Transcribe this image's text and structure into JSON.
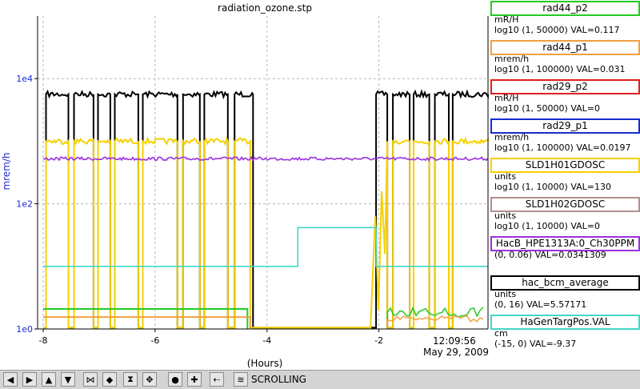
{
  "title": "radiation_ozone.stp",
  "y_axis_label": "mrem/h",
  "x_axis_label": "(Hours)",
  "time_label": "12:09:56",
  "date_label": "May 29, 2009",
  "y_ticks": [
    "1e4",
    "1e2",
    "1e0"
  ],
  "x_ticks": [
    "-8",
    "-6",
    "-4",
    "-2"
  ],
  "legend": [
    {
      "name": "rad44_p2",
      "unit": "mR/H",
      "range": "log10 (1, 50000) VAL=0.117",
      "color": "#22cc22"
    },
    {
      "name": "rad44_p1",
      "unit": "mrem/h",
      "range": "log10 (1, 100000) VAL=0.031",
      "color": "#f0a040"
    },
    {
      "name": "rad29_p2",
      "unit": "mR/H",
      "range": "log10 (1, 50000) VAL=0",
      "color": "#e02020"
    },
    {
      "name": "rad29_p1",
      "unit": "mrem/h",
      "range": "log10 (1, 100000) VAL=0.0197",
      "color": "#1a2ad0"
    },
    {
      "name": "SLD1H01GDOSC",
      "unit": "units",
      "range": "log10 (1, 10000) VAL=130",
      "color": "#f5d000"
    },
    {
      "name": "SLD1H02GDOSC",
      "unit": "units",
      "range": "log10 (1, 10000) VAL=0",
      "color": "#b09090"
    },
    {
      "name": "HacB_HPE1313A:0_Ch30PPM",
      "unit": "",
      "range": "(0, 0.06) VAL=0.0341309",
      "color": "#9a30e0"
    },
    {
      "name": "hac_bcm_average",
      "unit": "units",
      "range": "(0, 16) VAL=5.57171",
      "color": "#000000"
    },
    {
      "name": "HaGenTargPos.VAL",
      "unit": "cm",
      "range": "(-15, 0) VAL=-9.37",
      "color": "#40d8c8"
    }
  ],
  "toolbar": {
    "status_label": "SCROLLING",
    "buttons": [
      "pan-left-icon",
      "pan-right-icon",
      "pan-up-icon",
      "pan-down-icon",
      "zoom-in-x-icon",
      "zoom-out-x-icon",
      "zoom-in-y-icon",
      "zoom-out-y-icon",
      "autoscale-icon",
      "reset-icon",
      "add-icon",
      "back-icon",
      "config-icon",
      "print-icon"
    ]
  },
  "chart_data": {
    "type": "line",
    "title": "radiation_ozone.stp",
    "xlabel": "(Hours)",
    "ylabel": "mrem/h",
    "xlim": [
      -8.1,
      -0.05
    ],
    "ylim_log10": [
      0,
      5
    ],
    "y_scale": "log",
    "grid": true,
    "series": [
      {
        "name": "hac_bcm_average",
        "color": "#000000",
        "style": "toggle",
        "on_log10": 3.75,
        "off_log10": 0.0,
        "segments": [
          [
            -8.0,
            -7.95,
            "off"
          ],
          [
            -7.95,
            -7.55,
            "on"
          ],
          [
            -7.55,
            -7.45,
            "off"
          ],
          [
            -7.45,
            -7.1,
            "on"
          ],
          [
            -7.1,
            -7.02,
            "off"
          ],
          [
            -7.02,
            -6.8,
            "on"
          ],
          [
            -6.8,
            -6.72,
            "off"
          ],
          [
            -6.72,
            -6.3,
            "on"
          ],
          [
            -6.3,
            -6.22,
            "off"
          ],
          [
            -6.22,
            -5.6,
            "on"
          ],
          [
            -5.6,
            -5.5,
            "off"
          ],
          [
            -5.5,
            -5.2,
            "on"
          ],
          [
            -5.2,
            -5.12,
            "off"
          ],
          [
            -5.12,
            -4.7,
            "on"
          ],
          [
            -4.7,
            -4.58,
            "off"
          ],
          [
            -4.58,
            -4.25,
            "on"
          ],
          [
            -4.25,
            -2.05,
            "off"
          ],
          [
            -2.05,
            -1.85,
            "on"
          ],
          [
            -1.85,
            -1.75,
            "off"
          ],
          [
            -1.75,
            -1.45,
            "on"
          ],
          [
            -1.45,
            -1.38,
            "off"
          ],
          [
            -1.38,
            -1.1,
            "on"
          ],
          [
            -1.1,
            -1.0,
            "off"
          ],
          [
            -1.0,
            -0.75,
            "on"
          ],
          [
            -0.75,
            -0.68,
            "off"
          ],
          [
            -0.68,
            -0.05,
            "on"
          ]
        ]
      },
      {
        "name": "SLD1H01GDOSC",
        "color": "#f5d000",
        "style": "toggle",
        "on_log10": 3.0,
        "off_log10": 0.0,
        "segments": [
          [
            -8.0,
            -7.95,
            "off"
          ],
          [
            -7.95,
            -7.55,
            "on"
          ],
          [
            -7.55,
            -7.45,
            "off"
          ],
          [
            -7.45,
            -7.1,
            "on"
          ],
          [
            -7.1,
            -7.02,
            "off"
          ],
          [
            -7.02,
            -6.8,
            "on"
          ],
          [
            -6.8,
            -6.72,
            "off"
          ],
          [
            -6.72,
            -6.3,
            "on"
          ],
          [
            -6.3,
            -6.22,
            "off"
          ],
          [
            -6.22,
            -5.6,
            "on"
          ],
          [
            -5.6,
            -5.5,
            "off"
          ],
          [
            -5.5,
            -5.2,
            "on"
          ],
          [
            -5.2,
            -5.12,
            "off"
          ],
          [
            -5.12,
            -4.7,
            "on"
          ],
          [
            -4.7,
            -4.58,
            "off"
          ],
          [
            -4.58,
            -4.3,
            "on"
          ],
          [
            -4.3,
            -2.15,
            "off"
          ],
          [
            -2.15,
            -1.85,
            "ramp"
          ],
          [
            -1.85,
            -1.75,
            "off"
          ],
          [
            -1.75,
            -1.45,
            "on"
          ],
          [
            -1.45,
            -1.38,
            "off"
          ],
          [
            -1.38,
            -1.1,
            "on"
          ],
          [
            -1.1,
            -1.0,
            "off"
          ],
          [
            -1.0,
            -0.75,
            "on"
          ],
          [
            -0.75,
            -0.68,
            "off"
          ],
          [
            -0.68,
            -0.05,
            "on"
          ]
        ]
      },
      {
        "name": "HacB_HPE1313A:0_Ch30PPM",
        "color": "#9a30e0",
        "style": "flat",
        "value_log10": 2.72,
        "x_end": -0.05
      },
      {
        "name": "HaGenTargPos.VAL",
        "color": "#40d8c8",
        "points": [
          [
            -8.0,
            1.0
          ],
          [
            -3.45,
            1.0
          ],
          [
            -3.45,
            1.62
          ],
          [
            -2.05,
            1.62
          ],
          [
            -2.05,
            1.0
          ],
          [
            -0.05,
            1.0
          ]
        ]
      },
      {
        "name": "rad44_p2",
        "color": "#22cc22",
        "style": "low",
        "value_log10": 0.32,
        "x_start": -8.0,
        "x_end": -4.35
      },
      {
        "name": "rad44_p1",
        "color": "#f0a040",
        "style": "low",
        "value_log10": 0.19,
        "x_start": -8.0,
        "x_end": -4.3
      }
    ]
  }
}
